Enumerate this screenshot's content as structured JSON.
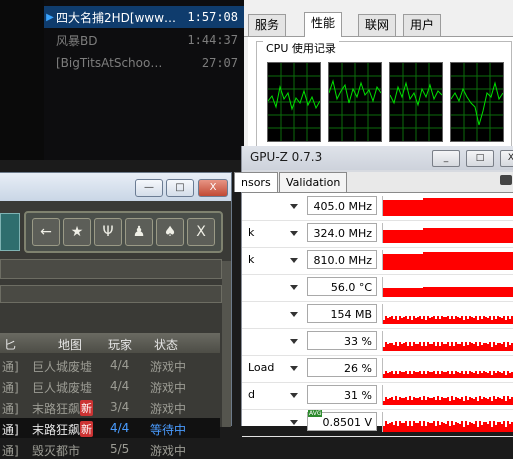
{
  "player": {
    "playlist": [
      {
        "title": "四大名捕2HD[www…",
        "duration": "1:57:08",
        "active": true
      },
      {
        "title": "风暴BD",
        "duration": "1:44:37",
        "active": false
      },
      {
        "title": "[BigTitsAtSchoo…",
        "duration": "27:07",
        "active": false
      }
    ]
  },
  "task_manager": {
    "tabs": [
      "服务",
      "性能",
      "联网",
      "用户"
    ],
    "selected_tab": "性能",
    "cpu_history_label": "CPU 使用记录",
    "cpu_cores": 4
  },
  "gpuz": {
    "title": "GPU-Z 0.7.3",
    "tabs": [
      "Sensors",
      "Validation"
    ],
    "tab_display": [
      "nsors",
      "Validation"
    ],
    "window_buttons": [
      "_",
      "□",
      "X"
    ],
    "sensors": [
      {
        "label": "",
        "value": "405.0 MHz",
        "level": 0.92
      },
      {
        "label": "k",
        "value": "324.0 MHz",
        "level": 0.75
      },
      {
        "label": "k",
        "value": "810.0 MHz",
        "level": 0.92
      },
      {
        "label": "",
        "value": "56.0 °C",
        "level": 0.5
      },
      {
        "label": "",
        "value": "154 MB",
        "level": 0.3
      },
      {
        "label": "",
        "value": "33 %",
        "level": 0.33
      },
      {
        "label": "Load",
        "value": "26 %",
        "level": 0.26
      },
      {
        "label": "d",
        "value": "31 %",
        "level": 0.31
      },
      {
        "label": "",
        "value": "0.8501 V",
        "level": 0.4
      }
    ],
    "avg_tag": "AVG"
  },
  "game": {
    "window_buttons": [
      "—",
      "□",
      "X"
    ],
    "toolbar_icons": [
      "←",
      "★",
      "Ψ",
      "♟",
      "♠",
      "X"
    ],
    "headers": [
      "匕",
      "地图",
      "玩家",
      "状态"
    ],
    "rows": [
      {
        "mode": "通]",
        "map": "巨人城废墟",
        "new": false,
        "players": "4/4",
        "status": "游戏中",
        "highlight": false
      },
      {
        "mode": "通]",
        "map": "巨人城废墟",
        "new": false,
        "players": "4/4",
        "status": "游戏中",
        "highlight": false
      },
      {
        "mode": "通]",
        "map": "末路狂飙",
        "new": true,
        "players": "3/4",
        "status": "游戏中",
        "highlight": false
      },
      {
        "mode": "通]",
        "map": "末路狂飙",
        "new": true,
        "players": "4/4",
        "status": "等待中",
        "highlight": true
      },
      {
        "mode": "通]",
        "map": "毁灭都市",
        "new": false,
        "players": "5/5",
        "status": "游戏中",
        "highlight": false
      }
    ],
    "new_badge": "新"
  }
}
